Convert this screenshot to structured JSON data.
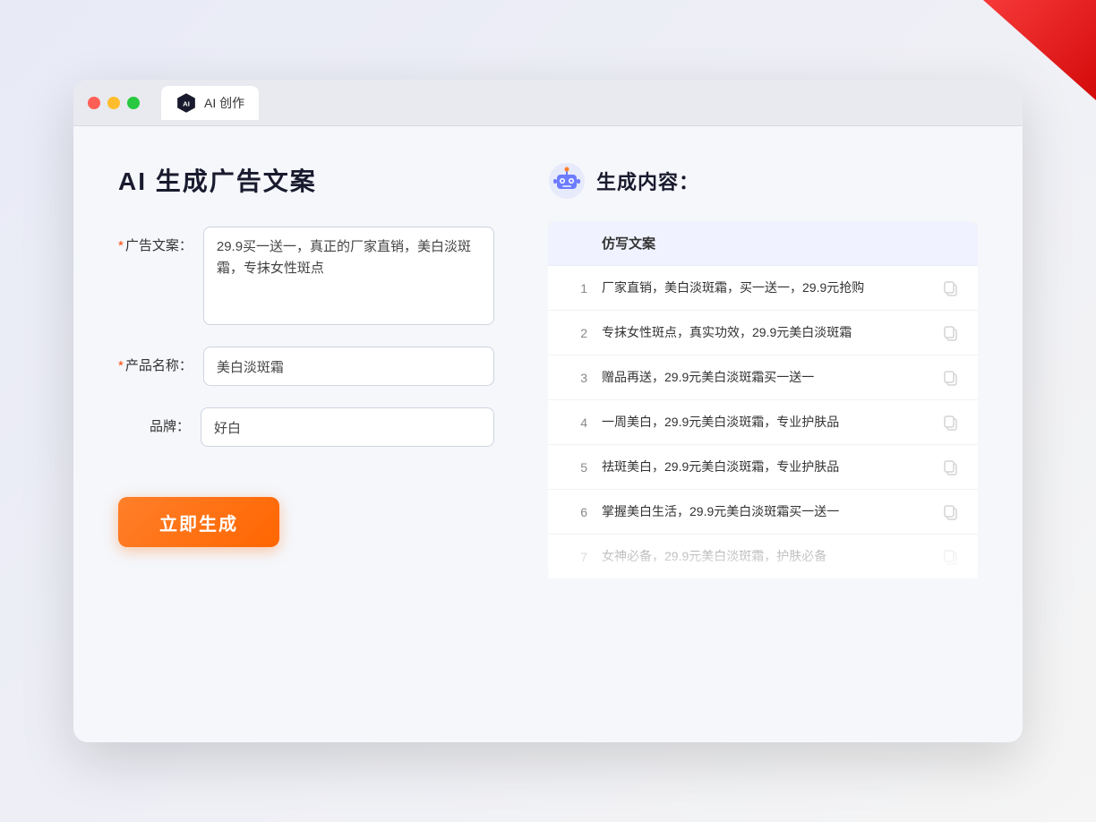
{
  "browser": {
    "tab_label": "AI 创作"
  },
  "page": {
    "title": "AI  生成广告文案",
    "form": {
      "ad_copy_label": "广告文案：",
      "ad_copy_required": "*",
      "ad_copy_value": "29.9买一送一，真正的厂家直销，美白淡斑霜，专抹女性斑点",
      "product_name_label": "产品名称：",
      "product_name_required": "*",
      "product_name_value": "美白淡斑霜",
      "brand_label": "品牌：",
      "brand_value": "好白",
      "generate_button": "立即生成"
    },
    "result": {
      "header": "生成内容：",
      "table_header": "仿写文案",
      "items": [
        {
          "num": "1",
          "text": "厂家直销，美白淡斑霜，买一送一，29.9元抢购",
          "dimmed": false
        },
        {
          "num": "2",
          "text": "专抹女性斑点，真实功效，29.9元美白淡斑霜",
          "dimmed": false
        },
        {
          "num": "3",
          "text": "赠品再送，29.9元美白淡斑霜买一送一",
          "dimmed": false
        },
        {
          "num": "4",
          "text": "一周美白，29.9元美白淡斑霜，专业护肤品",
          "dimmed": false
        },
        {
          "num": "5",
          "text": "祛斑美白，29.9元美白淡斑霜，专业护肤品",
          "dimmed": false
        },
        {
          "num": "6",
          "text": "掌握美白生活，29.9元美白淡斑霜买一送一",
          "dimmed": false
        },
        {
          "num": "7",
          "text": "女神必备，29.9元美白淡斑霜，护肤必备",
          "dimmed": true
        }
      ]
    }
  }
}
